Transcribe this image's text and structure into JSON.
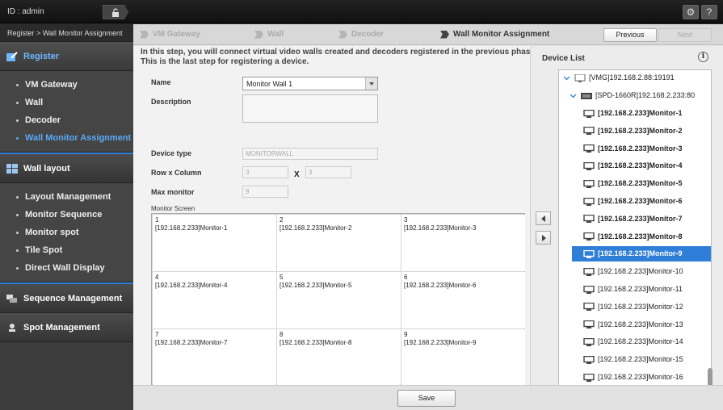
{
  "topbar": {
    "user_id": "ID : admin"
  },
  "sidebar": {
    "breadcrumb": "Register > Wall Monitor Assignment",
    "sections": {
      "register": "Register",
      "wall_layout": "Wall layout",
      "sequence_management": "Sequence Management",
      "spot_management": "Spot Management"
    },
    "register_items": [
      "VM Gateway",
      "Wall",
      "Decoder",
      "Wall Monitor Assignment"
    ],
    "wall_layout_items": [
      "Layout Management",
      "Monitor Sequence",
      "Monitor spot",
      "Tile Spot",
      "Direct Wall Display"
    ]
  },
  "steps": [
    "VM Gateway",
    "Wall",
    "Decoder",
    "Wall Monitor Assignment"
  ],
  "nav": {
    "previous": "Previous",
    "next": "Next"
  },
  "intro": {
    "line1": "In this step, you will connect virtual video walls created and decoders registered in the previous phase",
    "line2": "This is the last step for registering a device."
  },
  "form": {
    "name_label": "Name",
    "name_value": "Monitor Wall 1",
    "description_label": "Description",
    "device_type_label": "Device type",
    "device_type_value": "MONITORWALL",
    "row_col_label": "Row x Column",
    "rows": "3",
    "x": "X",
    "cols": "3",
    "max_monitor_label": "Max monitor",
    "max_monitor_value": "9",
    "monitor_screen_label": "Monitor Screen"
  },
  "grid_cells": [
    {
      "num": "1",
      "mon": "[192.168.2.233]Monitor-1"
    },
    {
      "num": "2",
      "mon": "[192.168.2.233]Monitor-2"
    },
    {
      "num": "3",
      "mon": "[192.168.2.233]Monitor-3"
    },
    {
      "num": "4",
      "mon": "[192.168.2.233]Monitor-4"
    },
    {
      "num": "5",
      "mon": "[192.168.2.233]Monitor-5"
    },
    {
      "num": "6",
      "mon": "[192.168.2.233]Monitor-6"
    },
    {
      "num": "7",
      "mon": "[192.168.2.233]Monitor-7"
    },
    {
      "num": "8",
      "mon": "[192.168.2.233]Monitor-8"
    },
    {
      "num": "9",
      "mon": "[192.168.2.233]Monitor-9"
    }
  ],
  "save_label": "Save",
  "device_list": {
    "title": "Device List",
    "info": "i",
    "vmg": "[VMG]192.168.2.88:19191",
    "decoder": "[SPD-1660R]192.168.2.233:80",
    "monitors": [
      "[192.168.2.233]Monitor-1",
      "[192.168.2.233]Monitor-2",
      "[192.168.2.233]Monitor-3",
      "[192.168.2.233]Monitor-4",
      "[192.168.2.233]Monitor-5",
      "[192.168.2.233]Monitor-6",
      "[192.168.2.233]Monitor-7",
      "[192.168.2.233]Monitor-8",
      "[192.168.2.233]Monitor-9",
      "[192.168.2.233]Monitor-10",
      "[192.168.2.233]Monitor-11",
      "[192.168.2.233]Monitor-12",
      "[192.168.2.233]Monitor-13",
      "[192.168.2.233]Monitor-14",
      "[192.168.2.233]Monitor-15",
      "[192.168.2.233]Monitor-16"
    ],
    "selected_index": 8,
    "assigned_count": 9
  },
  "colors": {
    "accent": "#2f7ed8",
    "sidebar_active": "#5aa9f5"
  }
}
